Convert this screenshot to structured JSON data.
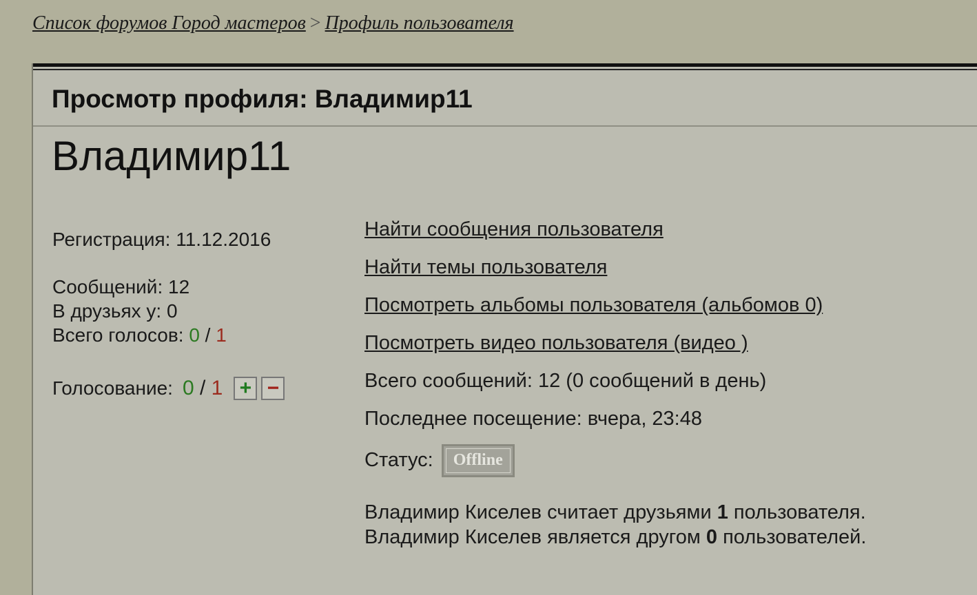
{
  "breadcrumb": {
    "forum_list": "Список форумов Город мастеров",
    "separator": ">",
    "profile": "Профиль пользователя"
  },
  "header": {
    "title": "Просмотр профиля: Владимир11"
  },
  "profile": {
    "username": "Владимир11",
    "registration": "Регистрация: 11.12.2016",
    "messages": "Сообщений: 12",
    "friends_of": "В друзьях у: 0",
    "total_votes_label": "Всего голосов:",
    "votes_positive": "0",
    "votes_slash": "/",
    "votes_negative": "1",
    "voting_label": "Голосование:",
    "plus_symbol": "+",
    "minus_symbol": "−"
  },
  "actions": {
    "find_messages": "Найти сообщения пользователя",
    "find_topics": "Найти темы пользователя",
    "view_albums": "Посмотреть альбомы пользователя (альбомов 0)",
    "view_videos": "Посмотреть видео пользователя (видео )"
  },
  "stats": {
    "total_messages": "Всего сообщений: 12 (0 сообщений в день)",
    "last_visit": "Последнее посещение: вчера, 23:48",
    "status_label": "Статус:",
    "status_value": "Offline"
  },
  "friends": {
    "line1_prefix": "Владимир Киселев считает друзьями",
    "line1_count": "1",
    "line1_suffix": "пользователя.",
    "line2_prefix": "Владимир Киселев является другом",
    "line2_count": "0",
    "line2_suffix": "пользователей."
  },
  "colors": {
    "background": "#b1b09b",
    "panel": "#bcbcb1",
    "positive": "#2c7a22",
    "negative": "#9b2b1e"
  }
}
